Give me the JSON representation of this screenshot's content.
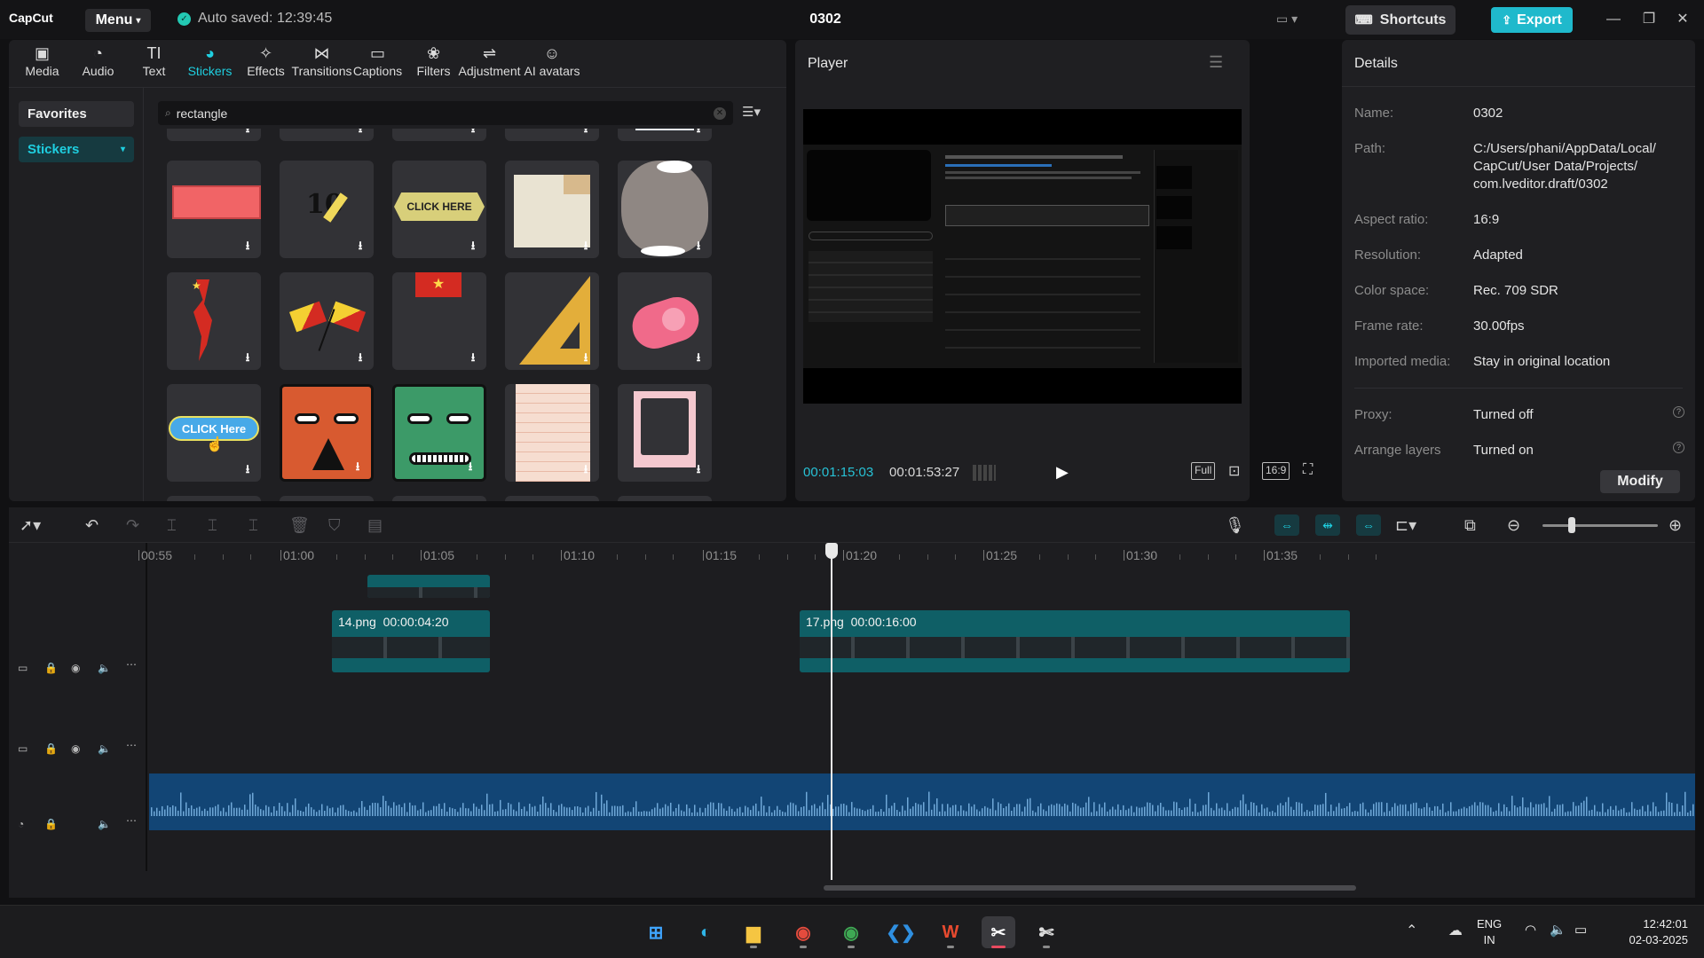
{
  "app": {
    "logo": "CapCut",
    "menu_label": "Menu",
    "autosave": "Auto saved: 12:39:45",
    "project_title": "0302",
    "shortcuts_label": "Shortcuts",
    "export_label": "Export",
    "accent_color": "#1fcfe0"
  },
  "tool_tabs": [
    {
      "label": "Media",
      "icon": "media-icon",
      "glyph": "▣"
    },
    {
      "label": "Audio",
      "icon": "audio-icon",
      "glyph": "◔"
    },
    {
      "label": "Text",
      "icon": "text-icon",
      "glyph": "TI"
    },
    {
      "label": "Stickers",
      "icon": "stickers-icon",
      "glyph": "◕"
    },
    {
      "label": "Effects",
      "icon": "effects-icon",
      "glyph": "✧"
    },
    {
      "label": "Transitions",
      "icon": "transitions-icon",
      "glyph": "⋈"
    },
    {
      "label": "Captions",
      "icon": "captions-icon",
      "glyph": "▭"
    },
    {
      "label": "Filters",
      "icon": "filters-icon",
      "glyph": "❀"
    },
    {
      "label": "Adjustment",
      "icon": "adjustment-icon",
      "glyph": "⇌"
    },
    {
      "label": "AI avatars",
      "icon": "ai-avatars-icon",
      "glyph": "☺"
    }
  ],
  "sidebar": {
    "favorites": "Favorites",
    "stickers": "Stickers"
  },
  "search": {
    "value": "rectangle"
  },
  "stickers_grid": [
    {
      "name": "red-rectangle-sticker"
    },
    {
      "name": "ten-ten-sticker",
      "text": "10"
    },
    {
      "name": "click-here-banner-sticker",
      "text": "CLICK HERE"
    },
    {
      "name": "paper-note-sticker"
    },
    {
      "name": "gray-blob-sticker"
    },
    {
      "name": "vietnam-map-sticker"
    },
    {
      "name": "signal-flags-sticker"
    },
    {
      "name": "vietnam-flag-sticker"
    },
    {
      "name": "set-square-sticker"
    },
    {
      "name": "whistle-sticker"
    },
    {
      "name": "click-here-button-sticker",
      "text": "CLICK Here"
    },
    {
      "name": "orange-face-sticker"
    },
    {
      "name": "green-face-sticker"
    },
    {
      "name": "notepad-sticker"
    },
    {
      "name": "photo-frame-sticker"
    }
  ],
  "player": {
    "title": "Player",
    "current_time": "00:01:15:03",
    "total_time": "00:01:53:27",
    "full_label": "Full",
    "ratio_label": "16:9"
  },
  "details": {
    "title": "Details",
    "fields": [
      {
        "key": "Name:",
        "value": "0302"
      },
      {
        "key": "Path:",
        "value": "C:/Users/phani/AppData/Local/\nCapCut/User Data/Projects/\ncom.lveditor.draft/0302"
      },
      {
        "key": "Aspect ratio:",
        "value": "16:9"
      },
      {
        "key": "Resolution:",
        "value": "Adapted"
      },
      {
        "key": "Color space:",
        "value": "Rec. 709 SDR"
      },
      {
        "key": "Frame rate:",
        "value": "30.00fps"
      },
      {
        "key": "Imported media:",
        "value": "Stay in original location"
      },
      {
        "key": "Proxy:",
        "value": "Turned off"
      },
      {
        "key": "Arrange layers",
        "value": "Turned on"
      }
    ],
    "modify_label": "Modify"
  },
  "timeline": {
    "ruler_labels": [
      "00:55",
      "01:00",
      "01:05",
      "01:10",
      "01:15",
      "01:20",
      "01:25",
      "01:30",
      "01:35"
    ],
    "clips": [
      {
        "label": "14.png  00:00:04:20"
      },
      {
        "label": "17.png  00:00:16:00"
      }
    ]
  },
  "taskbar": {
    "lang_line1": "ENG",
    "lang_line2": "IN",
    "time": "12:42:01",
    "date": "02-03-2025"
  }
}
